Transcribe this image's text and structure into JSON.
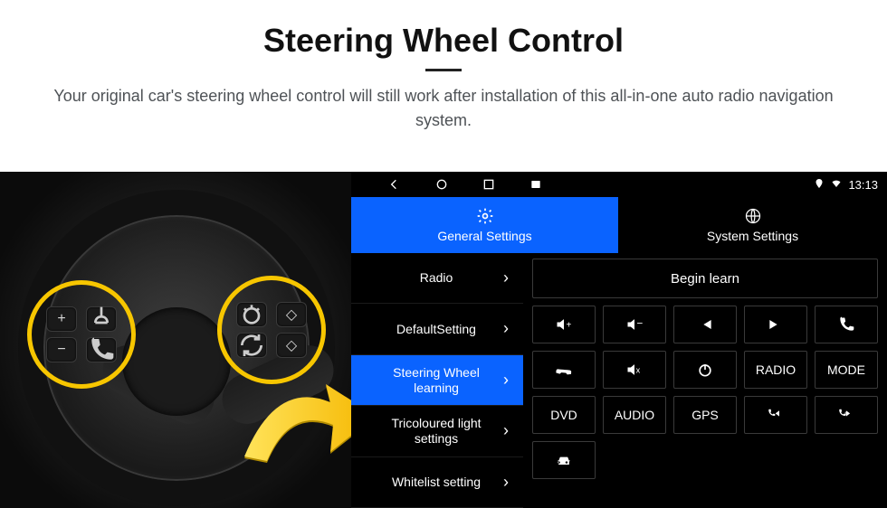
{
  "header": {
    "title": "Steering Wheel Control",
    "subtitle": "Your original car's steering wheel control will still work after installation of this all-in-one auto radio navigation system."
  },
  "statusbar": {
    "time": "13:13"
  },
  "tabs": {
    "general": "General Settings",
    "system": "System Settings"
  },
  "sidebar": [
    {
      "label": "Radio",
      "active": false
    },
    {
      "label": "DefaultSetting",
      "active": false
    },
    {
      "label": "Steering Wheel learning",
      "active": true
    },
    {
      "label": "Tricoloured light settings",
      "active": false
    },
    {
      "label": "Whitelist setting",
      "active": false
    }
  ],
  "main": {
    "begin_label": "Begin learn",
    "buttons": [
      {
        "name": "vol-up",
        "label": "",
        "icon": "vol-up"
      },
      {
        "name": "vol-down",
        "label": "",
        "icon": "vol-down"
      },
      {
        "name": "prev",
        "label": "",
        "icon": "prev"
      },
      {
        "name": "next",
        "label": "",
        "icon": "next"
      },
      {
        "name": "call",
        "label": "",
        "icon": "call"
      },
      {
        "name": "hangup",
        "label": "",
        "icon": "hangup"
      },
      {
        "name": "mute",
        "label": "",
        "icon": "mute"
      },
      {
        "name": "power",
        "label": "",
        "icon": "power"
      },
      {
        "name": "radio",
        "label": "RADIO"
      },
      {
        "name": "mode",
        "label": "MODE"
      },
      {
        "name": "dvd",
        "label": "DVD"
      },
      {
        "name": "audio",
        "label": "AUDIO"
      },
      {
        "name": "gps",
        "label": "GPS"
      },
      {
        "name": "call-prev",
        "label": "",
        "icon": "call-prev"
      },
      {
        "name": "call-next",
        "label": "",
        "icon": "call-next"
      },
      {
        "name": "car",
        "label": "",
        "icon": "car"
      }
    ]
  },
  "wheel_buttons": {
    "left": [
      "+",
      "voice",
      "−",
      "phone"
    ],
    "right": [
      "dash",
      "diamond",
      "cycle",
      "diamond2"
    ]
  }
}
